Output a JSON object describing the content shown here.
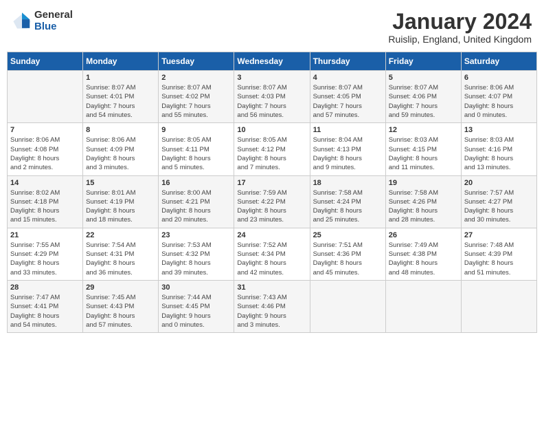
{
  "header": {
    "logo_general": "General",
    "logo_blue": "Blue",
    "title": "January 2024",
    "location": "Ruislip, England, United Kingdom"
  },
  "days_of_week": [
    "Sunday",
    "Monday",
    "Tuesday",
    "Wednesday",
    "Thursday",
    "Friday",
    "Saturday"
  ],
  "weeks": [
    [
      {
        "day": "",
        "info": ""
      },
      {
        "day": "1",
        "info": "Sunrise: 8:07 AM\nSunset: 4:01 PM\nDaylight: 7 hours\nand 54 minutes."
      },
      {
        "day": "2",
        "info": "Sunrise: 8:07 AM\nSunset: 4:02 PM\nDaylight: 7 hours\nand 55 minutes."
      },
      {
        "day": "3",
        "info": "Sunrise: 8:07 AM\nSunset: 4:03 PM\nDaylight: 7 hours\nand 56 minutes."
      },
      {
        "day": "4",
        "info": "Sunrise: 8:07 AM\nSunset: 4:05 PM\nDaylight: 7 hours\nand 57 minutes."
      },
      {
        "day": "5",
        "info": "Sunrise: 8:07 AM\nSunset: 4:06 PM\nDaylight: 7 hours\nand 59 minutes."
      },
      {
        "day": "6",
        "info": "Sunrise: 8:06 AM\nSunset: 4:07 PM\nDaylight: 8 hours\nand 0 minutes."
      }
    ],
    [
      {
        "day": "7",
        "info": "Sunrise: 8:06 AM\nSunset: 4:08 PM\nDaylight: 8 hours\nand 2 minutes."
      },
      {
        "day": "8",
        "info": "Sunrise: 8:06 AM\nSunset: 4:09 PM\nDaylight: 8 hours\nand 3 minutes."
      },
      {
        "day": "9",
        "info": "Sunrise: 8:05 AM\nSunset: 4:11 PM\nDaylight: 8 hours\nand 5 minutes."
      },
      {
        "day": "10",
        "info": "Sunrise: 8:05 AM\nSunset: 4:12 PM\nDaylight: 8 hours\nand 7 minutes."
      },
      {
        "day": "11",
        "info": "Sunrise: 8:04 AM\nSunset: 4:13 PM\nDaylight: 8 hours\nand 9 minutes."
      },
      {
        "day": "12",
        "info": "Sunrise: 8:03 AM\nSunset: 4:15 PM\nDaylight: 8 hours\nand 11 minutes."
      },
      {
        "day": "13",
        "info": "Sunrise: 8:03 AM\nSunset: 4:16 PM\nDaylight: 8 hours\nand 13 minutes."
      }
    ],
    [
      {
        "day": "14",
        "info": "Sunrise: 8:02 AM\nSunset: 4:18 PM\nDaylight: 8 hours\nand 15 minutes."
      },
      {
        "day": "15",
        "info": "Sunrise: 8:01 AM\nSunset: 4:19 PM\nDaylight: 8 hours\nand 18 minutes."
      },
      {
        "day": "16",
        "info": "Sunrise: 8:00 AM\nSunset: 4:21 PM\nDaylight: 8 hours\nand 20 minutes."
      },
      {
        "day": "17",
        "info": "Sunrise: 7:59 AM\nSunset: 4:22 PM\nDaylight: 8 hours\nand 23 minutes."
      },
      {
        "day": "18",
        "info": "Sunrise: 7:58 AM\nSunset: 4:24 PM\nDaylight: 8 hours\nand 25 minutes."
      },
      {
        "day": "19",
        "info": "Sunrise: 7:58 AM\nSunset: 4:26 PM\nDaylight: 8 hours\nand 28 minutes."
      },
      {
        "day": "20",
        "info": "Sunrise: 7:57 AM\nSunset: 4:27 PM\nDaylight: 8 hours\nand 30 minutes."
      }
    ],
    [
      {
        "day": "21",
        "info": "Sunrise: 7:55 AM\nSunset: 4:29 PM\nDaylight: 8 hours\nand 33 minutes."
      },
      {
        "day": "22",
        "info": "Sunrise: 7:54 AM\nSunset: 4:31 PM\nDaylight: 8 hours\nand 36 minutes."
      },
      {
        "day": "23",
        "info": "Sunrise: 7:53 AM\nSunset: 4:32 PM\nDaylight: 8 hours\nand 39 minutes."
      },
      {
        "day": "24",
        "info": "Sunrise: 7:52 AM\nSunset: 4:34 PM\nDaylight: 8 hours\nand 42 minutes."
      },
      {
        "day": "25",
        "info": "Sunrise: 7:51 AM\nSunset: 4:36 PM\nDaylight: 8 hours\nand 45 minutes."
      },
      {
        "day": "26",
        "info": "Sunrise: 7:49 AM\nSunset: 4:38 PM\nDaylight: 8 hours\nand 48 minutes."
      },
      {
        "day": "27",
        "info": "Sunrise: 7:48 AM\nSunset: 4:39 PM\nDaylight: 8 hours\nand 51 minutes."
      }
    ],
    [
      {
        "day": "28",
        "info": "Sunrise: 7:47 AM\nSunset: 4:41 PM\nDaylight: 8 hours\nand 54 minutes."
      },
      {
        "day": "29",
        "info": "Sunrise: 7:45 AM\nSunset: 4:43 PM\nDaylight: 8 hours\nand 57 minutes."
      },
      {
        "day": "30",
        "info": "Sunrise: 7:44 AM\nSunset: 4:45 PM\nDaylight: 9 hours\nand 0 minutes."
      },
      {
        "day": "31",
        "info": "Sunrise: 7:43 AM\nSunset: 4:46 PM\nDaylight: 9 hours\nand 3 minutes."
      },
      {
        "day": "",
        "info": ""
      },
      {
        "day": "",
        "info": ""
      },
      {
        "day": "",
        "info": ""
      }
    ]
  ]
}
